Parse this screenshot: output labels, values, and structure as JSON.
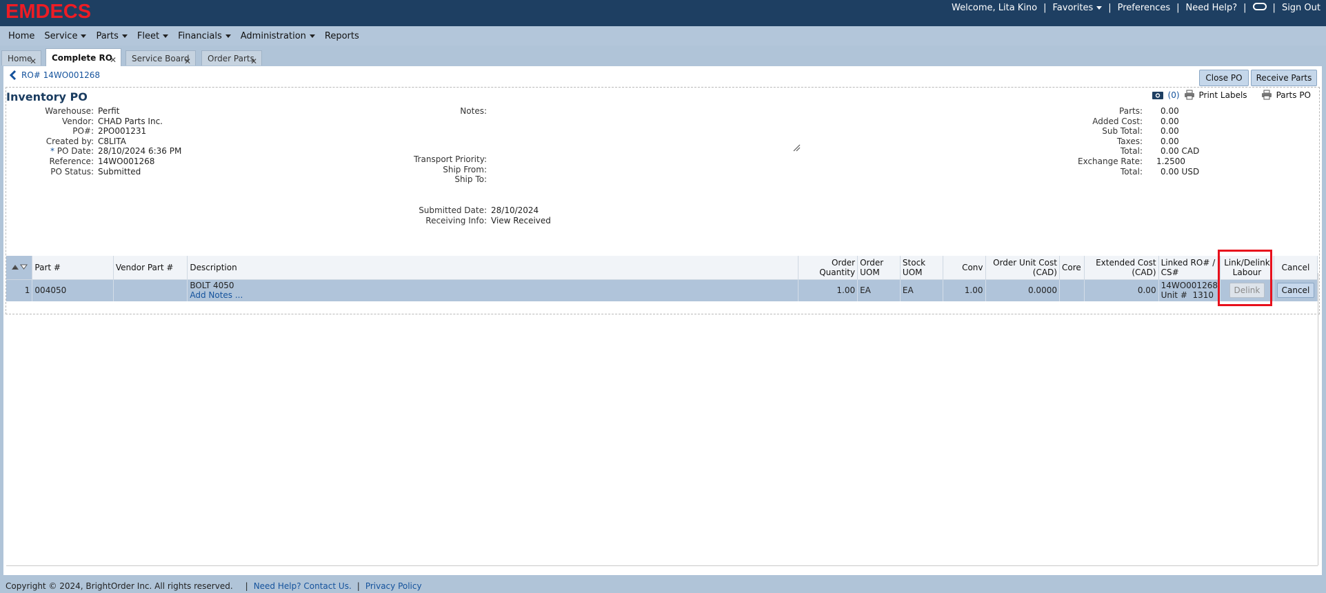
{
  "app": {
    "logo": "EMDECS",
    "welcome": "Welcome, Lita Kino",
    "favorites": "Favorites",
    "preferences": "Preferences",
    "need_help": "Need Help?",
    "sign_out": "Sign Out",
    "brand_color": "#ee1c24",
    "header_color": "#1e3f62"
  },
  "menu": [
    "Home",
    "Service",
    "Parts",
    "Fleet",
    "Financials",
    "Administration",
    "Reports"
  ],
  "tabs": [
    "Home",
    "Complete RO",
    "Service Board",
    "Order Parts"
  ],
  "breadcrumb": "RO# 14WO001268",
  "buttons": {
    "close_po": "Close PO",
    "receive_parts": "Receive Parts"
  },
  "po": {
    "title": "Inventory PO",
    "attachments": "(0)",
    "print_labels": "Print Labels",
    "parts_po": "Parts PO",
    "left_fields": [
      {
        "label": "Warehouse:",
        "value": "Perfit"
      },
      {
        "label": "Vendor:",
        "value": "CHAD Parts Inc."
      },
      {
        "label": "PO#:",
        "value": "2PO001231"
      },
      {
        "label": "Created by:",
        "value": "C8LITA"
      },
      {
        "label": "PO Date:",
        "value": "28/10/2024 6:36 PM",
        "required": "*"
      },
      {
        "label": "Reference:",
        "value": "14WO001268"
      },
      {
        "label": "PO Status:",
        "value": "Submitted",
        "link": true
      }
    ],
    "notes_label": "Notes:",
    "transport_priority": "Transport Priority:",
    "ship_from": "Ship From:",
    "ship_to": "Ship To:",
    "submitted_date_label": "Submitted Date:",
    "submitted_date": "28/10/2024",
    "receiving_info_label": "Receiving Info:",
    "view_received": "View Received",
    "totals": [
      {
        "label": "Parts:",
        "value": "0.00",
        "unit": ""
      },
      {
        "label": "Added Cost:",
        "value": "0.00",
        "unit": "",
        "link": true
      },
      {
        "label": "Sub Total:",
        "value": "0.00",
        "unit": ""
      },
      {
        "label": "Taxes:",
        "value": "0.00",
        "unit": "",
        "link": true
      },
      {
        "label": "Total:",
        "value": "0.00",
        "unit": "CAD"
      },
      {
        "label": "Exchange Rate:",
        "value": "1.2500",
        "unit": ""
      },
      {
        "label": "Total:",
        "value": "0.00",
        "unit": "USD"
      }
    ]
  },
  "grid": {
    "columns": {
      "part": "Part #",
      "vendor_part": "Vendor Part #",
      "description": "Description",
      "order_qty_1": "Order",
      "order_qty_2": "Quantity",
      "order_uom_1": "Order",
      "order_uom_2": "UOM",
      "stock_uom_1": "Stock",
      "stock_uom_2": "UOM",
      "conv": "Conv",
      "unit_cost_1": "Order Unit Cost",
      "unit_cost_2": "(CAD)",
      "core": "Core",
      "ext_cost_1": "Extended Cost",
      "ext_cost_2": "(CAD)",
      "linked_1": "Linked RO# /",
      "linked_2": "CS#",
      "link_1": "Link/Delink",
      "link_2": "Labour",
      "cancel": "Cancel"
    },
    "rows": [
      {
        "num": "1",
        "part": "004050",
        "vendor_part": "",
        "description": "BOLT 4050",
        "add_notes": "Add Notes ...",
        "order_qty": "1.00",
        "order_uom": "EA",
        "stock_uom": "EA",
        "conv": "1.00",
        "unit_cost": "0.0000",
        "core": "",
        "ext_cost": "0.00",
        "linked_ro": "14WO001268",
        "unit_label": "Unit #",
        "unit_no": "1310",
        "delink": "Delink",
        "cancel": "Cancel"
      }
    ]
  },
  "footer": {
    "copyright": "Copyright © 2024, BrightOrder Inc. All rights reserved.",
    "help": "Need Help? Contact Us.",
    "privacy": "Privacy Policy"
  }
}
